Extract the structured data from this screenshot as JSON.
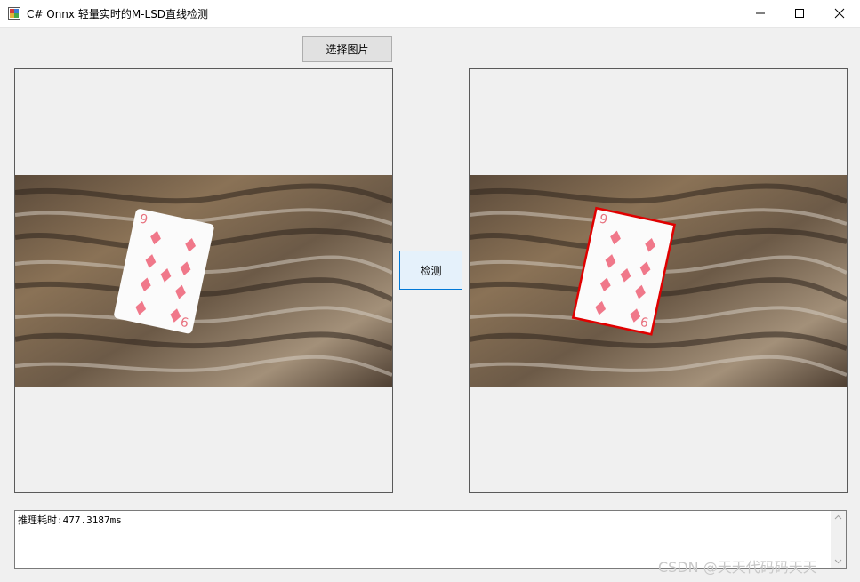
{
  "window": {
    "title": "C# Onnx 轻量实时的M-LSD直线检测"
  },
  "toolbar": {
    "select_image_label": "选择图片",
    "detect_label": "检测"
  },
  "output": {
    "log_text": "推理耗时:477.3187ms"
  },
  "watermark": {
    "text": "CSDN @天天代码码天天"
  },
  "colors": {
    "detected_line": "#e00000",
    "button_focus_border": "#0078d7"
  }
}
